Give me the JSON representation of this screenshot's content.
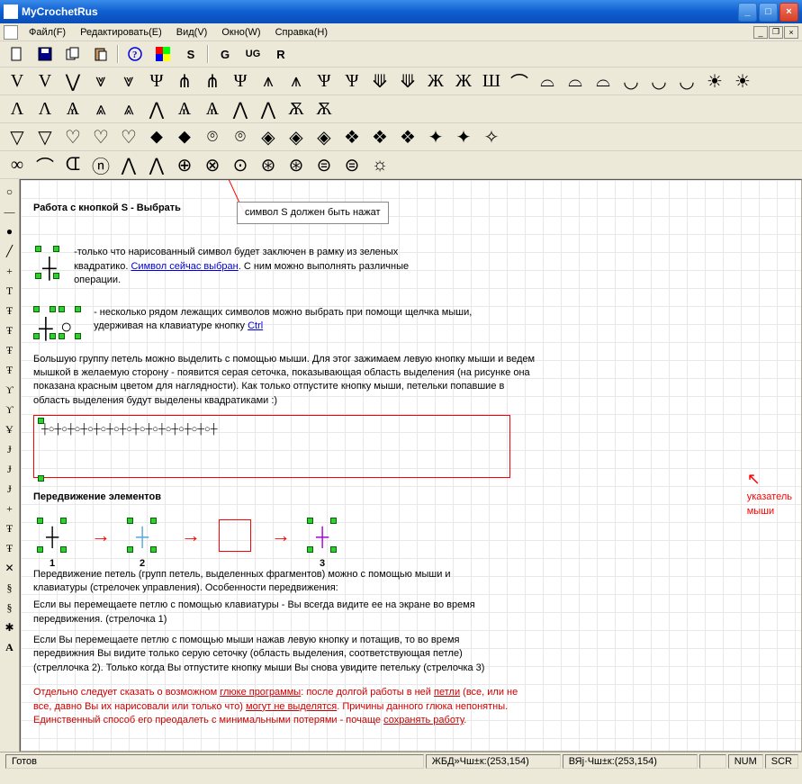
{
  "window": {
    "title": "MyCrochetRus"
  },
  "menus": {
    "file": "Файл(F)",
    "edit": "Редактировать(E)",
    "view": "Вид(V)",
    "window": "Окно(W)",
    "help": "Справка(H)"
  },
  "toolbar1": {
    "s": "S",
    "g": "G",
    "ug": "UG",
    "r": "R"
  },
  "doc": {
    "h1": "Работа с кнопкой S - Выбрать",
    "callout1": "символ S должен быть нажат",
    "p1a": "-только что нарисованный символ будет заключен в рамку из зеленых квадратико. ",
    "p1b": "Символ сейчас выбран",
    "p1c": ". С ним можно выполнять различные операции.",
    "p2a": "- несколько рядом лежащих символов можно выбрать при помощи щелчка мыши, удерживая на клавиатуре кнопку ",
    "p2b": "Ctrl",
    "p3": "Большую группу петель можно выделить с помощью мыши. Для этог зажимаем левую кнопку мыши и ведем мышкой в желаемую сторону - появится серая сеточка, показывающая область выделения (на рисунке она показана красным цветом для наглядности). Как только отпустите кнопку мыши, петельки попавшие в область выделения будут выделены квадратиками :)",
    "pointer": "указатель\nмыши",
    "h2": "Передвижение элементов",
    "step1": "1",
    "step2": "2",
    "step3": "3",
    "p4": "Передвижение петель (групп петель, выделенных фрагментов) можно с помощью мыши и клавиатуры (стрелочек управления). Особенности передвижения:",
    "p5": "Если вы перемещаете петлю с помощью клавиатуры - Вы всегда видите ее на экране во время передвижения. (стрелочка 1)",
    "p6": "Если Вы перемещаете петлю с помощью мыши нажав левую кнопку и потащив, то во время передвижния Вы видите только серую сеточку (область выделения, соответствующая петле) (стреллочка 2). Только когда Вы отпустите кнопку мыши Вы снова увидите петельку (стрелочка 3)",
    "p7a": "Отдельно следует сказать о возможном ",
    "p7b": "глюке программы",
    "p7c": ": после долгой работы в ней ",
    "p7d": "петли",
    "p7e": " (все, или не все, давно Вы их нарисовали или только что) ",
    "p7f": "могут не выделятся",
    "p7g": ". Причины данного глюка непонятны. Единственный способ его преодалеть с минимальными потерями - почаще ",
    "p7h": "сохранять работу",
    "p7i": "."
  },
  "status": {
    "ready": "Готов",
    "coord1": "ЖБД»Чш±к:(253,154)",
    "coord2": "ВЯј·Чш±к:(253,154)",
    "num": "NUM",
    "scr": "SCR"
  }
}
